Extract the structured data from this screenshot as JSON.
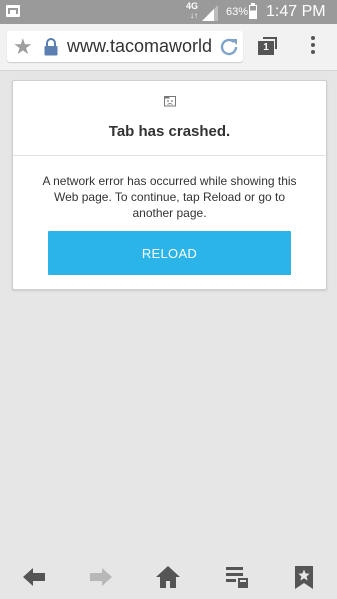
{
  "status_bar": {
    "network_type": "4G",
    "network_arrows": "↓↑",
    "battery_percent": "63%",
    "battery_level": 0.63,
    "time": "1:47 PM"
  },
  "toolbar": {
    "url": "www.tacomaworld",
    "tab_count": "1",
    "icons": [
      "star-icon",
      "lock-icon",
      "reload-icon",
      "tabs-icon",
      "overflow-menu-icon"
    ]
  },
  "crash_card": {
    "title": "Tab has crashed.",
    "message": "A network error has occurred while showing this Web page. To continue, tap Reload or go to another page.",
    "reload_label": "RELOAD",
    "accent_color": "#2ab4e8"
  },
  "bottom_bar": {
    "icons": [
      "back-icon",
      "forward-icon",
      "home-icon",
      "reading-list-icon",
      "bookmarks-icon"
    ]
  }
}
